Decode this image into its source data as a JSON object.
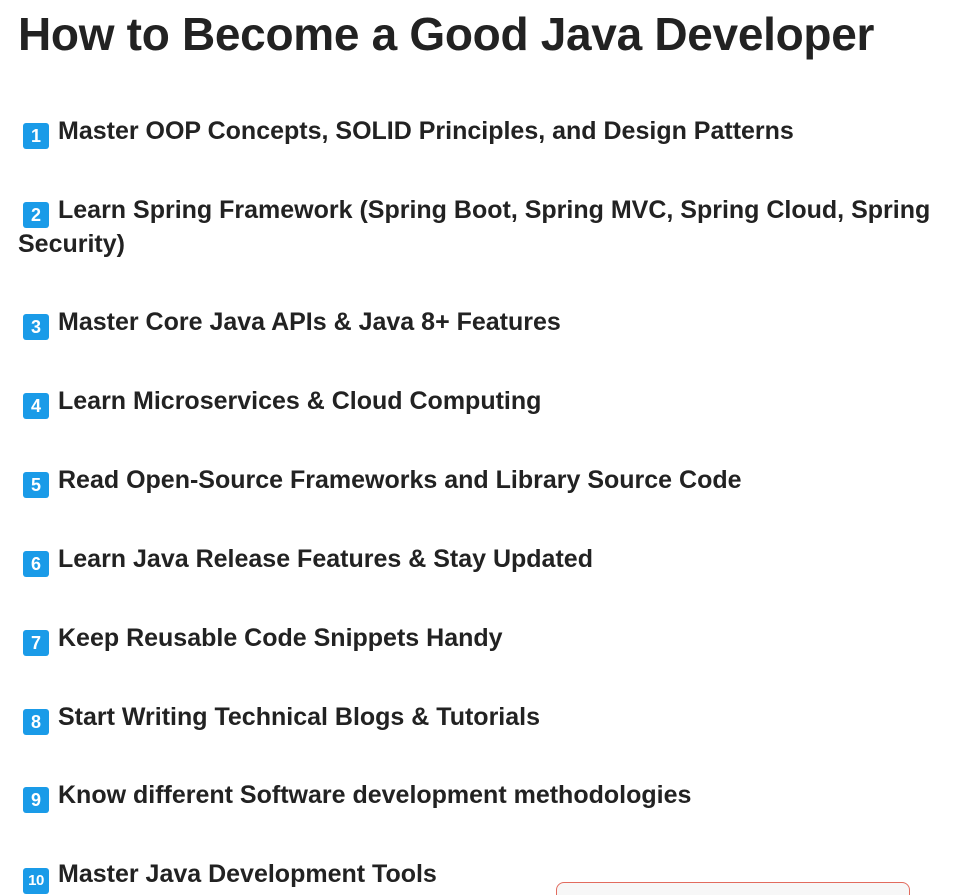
{
  "article": {
    "title": "How to Become a Good Java Developer",
    "items": [
      {
        "num": "1",
        "text": "Master OOP Concepts, SOLID Principles, and Design Patterns"
      },
      {
        "num": "2",
        "text": "Learn Spring Framework (Spring Boot, Spring MVC, Spring Cloud, Spring",
        "cont": "Security)"
      },
      {
        "num": "3",
        "text": "Master Core Java APIs & Java 8+ Features"
      },
      {
        "num": "4",
        "text": "Learn Microservices & Cloud Computing"
      },
      {
        "num": "5",
        "text": "Read Open-Source Frameworks and Library Source Code"
      },
      {
        "num": "6",
        "text": "Learn Java Release Features & Stay Updated"
      },
      {
        "num": "7",
        "text": "Keep Reusable Code Snippets Handy"
      },
      {
        "num": "8",
        "text": "Start Writing Technical Blogs & Tutorials"
      },
      {
        "num": "9",
        "text": "Know different Software development methodologies"
      },
      {
        "num": "10",
        "text": "Master Java Development Tools"
      }
    ]
  },
  "icons": {
    "badge": "keycap-number-icon",
    "badge_color": "#1a9be8"
  }
}
